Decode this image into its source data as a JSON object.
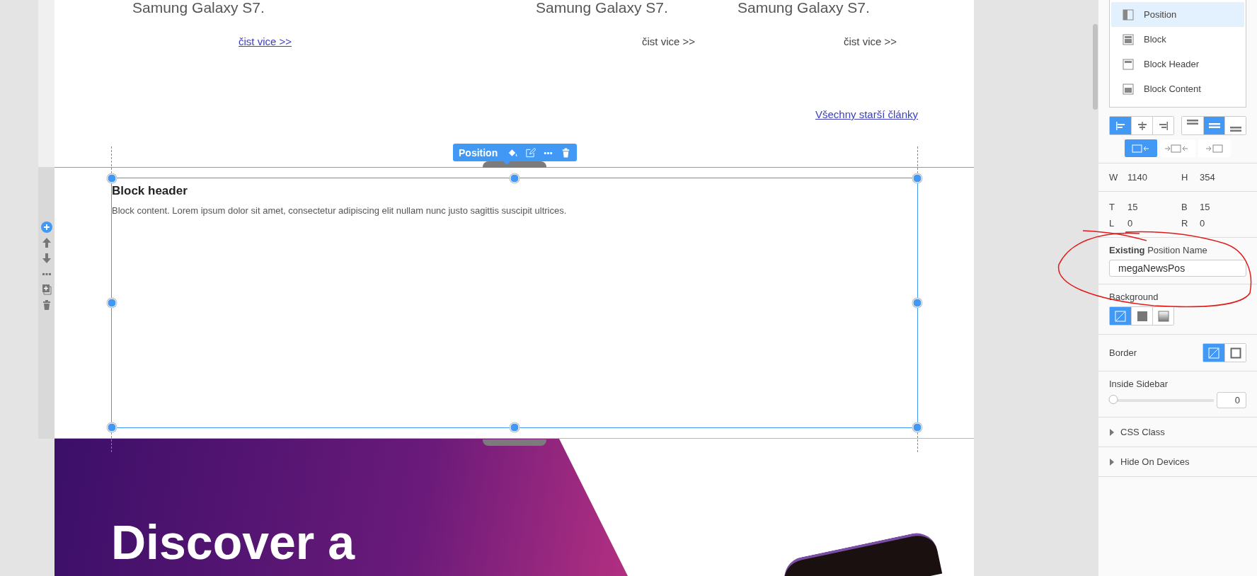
{
  "articles": [
    {
      "title": "Samung Galaxy S7.",
      "link": "čist vice >>",
      "underlined": true
    },
    {
      "title": "Samung Galaxy S7.",
      "link": "čist vice >>",
      "underlined": false
    },
    {
      "title": "Samung Galaxy S7.",
      "link": "čist vice >>",
      "underlined": false
    }
  ],
  "older_link": "Všechny starší články",
  "element_toolbar": {
    "label": "Position"
  },
  "block": {
    "header": "Block header",
    "content": "Block content. Lorem ipsum dolor sit amet, consectetur adipiscing elit nullam nunc justo sagittis suscipit ultrices."
  },
  "hero": {
    "heading": "Discover a"
  },
  "panel": {
    "layers": [
      {
        "label": "Position",
        "kind": "position",
        "selected": true
      },
      {
        "label": "Block",
        "kind": "block",
        "selected": false
      },
      {
        "label": "Block Header",
        "kind": "header",
        "selected": false
      },
      {
        "label": "Block Content",
        "kind": "content",
        "selected": false
      }
    ],
    "h_align": [
      {
        "kind": "left",
        "selected": true
      },
      {
        "kind": "center",
        "selected": false
      },
      {
        "kind": "right",
        "selected": false
      }
    ],
    "v_align": [
      {
        "kind": "top",
        "selected": false
      },
      {
        "kind": "middle",
        "selected": true
      },
      {
        "kind": "bottom",
        "selected": false
      }
    ],
    "width_mode": [
      {
        "kind": "fit",
        "selected": true
      },
      {
        "kind": "stretch",
        "selected": false
      },
      {
        "kind": "push",
        "selected": false
      }
    ],
    "size": [
      {
        "label": "W",
        "value": "1140"
      },
      {
        "label": "H",
        "value": "354"
      }
    ],
    "spacing": [
      {
        "label": "T",
        "value": "15"
      },
      {
        "label": "B",
        "value": "15"
      },
      {
        "label": "L",
        "value": "0"
      },
      {
        "label": "R",
        "value": "0"
      }
    ],
    "position_name": {
      "label_bold": "Existing",
      "label": "Position Name",
      "value": "megaNewsPos"
    },
    "background": {
      "label": "Background",
      "options": [
        {
          "kind": "none",
          "selected": true
        },
        {
          "kind": "solid",
          "selected": false
        },
        {
          "kind": "gradient",
          "selected": false
        }
      ]
    },
    "border": {
      "label": "Border",
      "options": [
        {
          "kind": "none",
          "selected": true
        },
        {
          "kind": "solid",
          "selected": false
        }
      ]
    },
    "inside_sidebar": {
      "label": "Inside Sidebar",
      "level": 0,
      "value": "0"
    },
    "sections": [
      {
        "label": "CSS Class",
        "expanded": false
      },
      {
        "label": "Hide On Devices",
        "expanded": false
      }
    ]
  }
}
